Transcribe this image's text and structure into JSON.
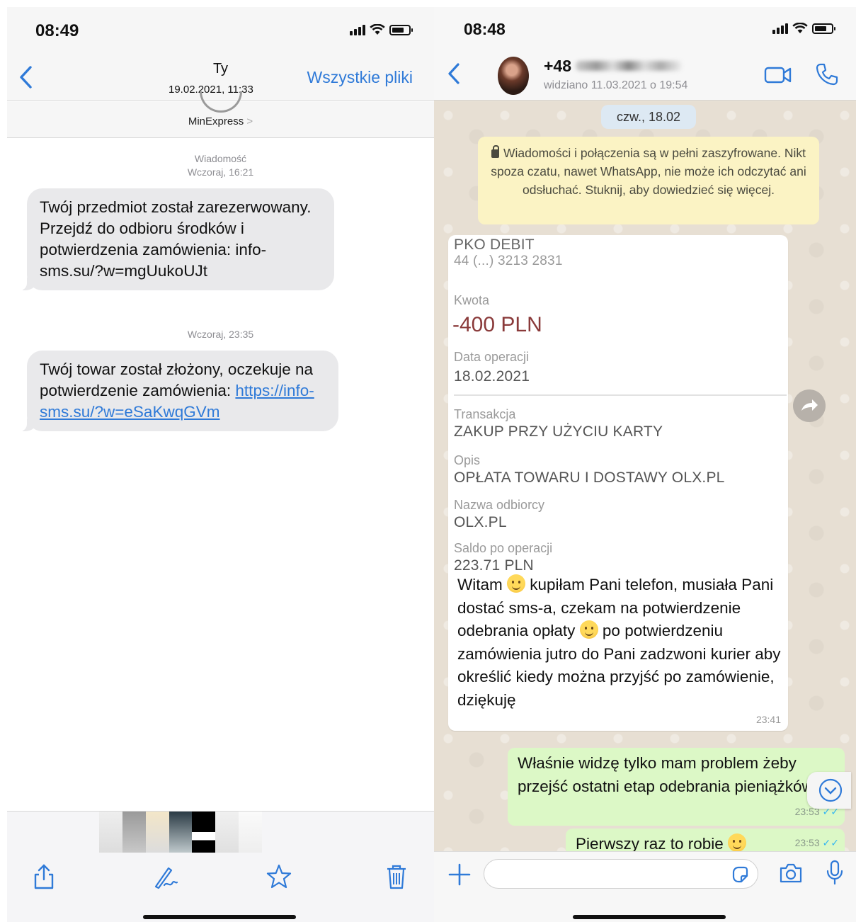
{
  "left": {
    "status": {
      "time": "08:49"
    },
    "nav": {
      "contact": "Ty",
      "date": "19.02.2021, 11:33",
      "all_files": "Wszystkie pliki"
    },
    "sender": {
      "name": "MinExpress",
      "chevron": ">"
    },
    "messages": [
      {
        "stamp_title": "Wiadomość",
        "stamp": "Wczoraj, 16:21",
        "text": "Twój przedmiot został zarezerwowany. Przejdź do odbioru środków i potwierdzenia zamówienia: info-sms.su/?w=mgUukoUJt"
      },
      {
        "stamp": "Wczoraj, 23:35",
        "text": "Twój towar został złożony, oczekuje na potwierdzenie zamówienia:",
        "link": "https://info-sms.su/?w=eSaKwqGVm"
      }
    ],
    "toolbar": {
      "icons": [
        "share-icon",
        "markup-icon",
        "star-icon",
        "trash-icon"
      ]
    }
  },
  "right": {
    "status": {
      "time": "08:48"
    },
    "nav": {
      "number": "+48",
      "seen": "widziano 11.03.2021 o 19:54",
      "icons": [
        "video-call-icon",
        "voice-call-icon"
      ]
    },
    "day_pill": "czw., 18.02",
    "notice": "Wiadomości i połączenia są w pełni zaszyfrowane. Nikt spoza czatu, nawet WhatsApp, nie może ich odczytać ani odsłuchać. Stuknij, aby dowiedzieć się więcej.",
    "bank": {
      "header": "PKO DEBIT",
      "account": "44 (...) 3213 2831",
      "amount_label": "Kwota",
      "amount": "-400 PLN",
      "date_label": "Data operacji",
      "date": "18.02.2021",
      "transaction_label": "Transakcja",
      "transaction": "ZAKUP PRZY UŻYCIU KARTY",
      "description_label": "Opis",
      "description": "OPŁATA TOWARU I DOSTAWY OLX.PL",
      "recipient_label": "Nazwa odbiorcy",
      "recipient": "OLX.PL",
      "balance_label": "Saldo po operacji",
      "balance": "223.71 PLN"
    },
    "incoming": {
      "part1": "Witam",
      "part2": "kupiłam Pani telefon, musiała Pani dostać sms-a, czekam na potwierdzenie odebrania opłaty",
      "part3": "po potwierdzeniu zamówienia jutro do Pani zadzwoni kurier aby określić kiedy można przyjść po zamówienie, dziękuję",
      "time": "23:41"
    },
    "outgoing": [
      {
        "text": "Właśnie widzę tylko mam problem żeby przejść ostatni etap odebrania pieniążków",
        "time": "23:53"
      },
      {
        "text": "Pierwszy raz to robie",
        "time": "23:53"
      }
    ],
    "colors": {
      "accent": "#2f7ad8",
      "bubble_out": "#dcf8c6",
      "notice": "#fbf3c4"
    }
  }
}
